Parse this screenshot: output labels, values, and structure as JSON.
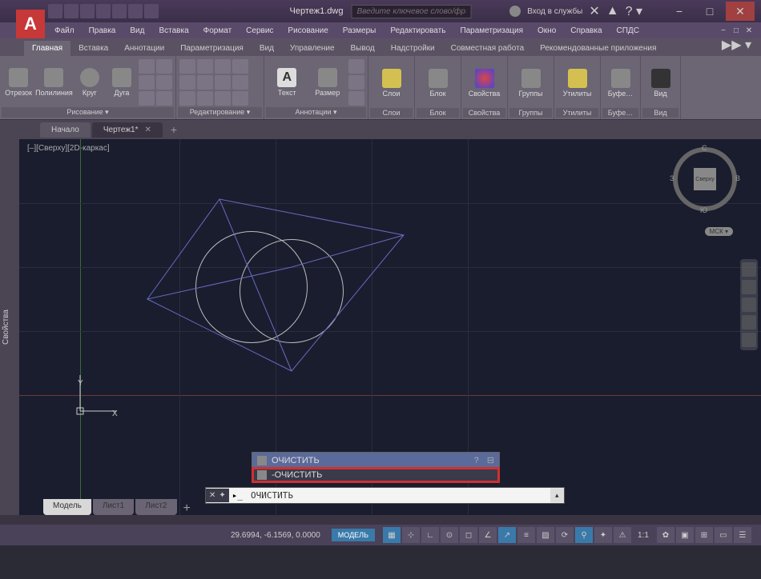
{
  "titlebar": {
    "doc_title": "Чертеж1.dwg",
    "search_placeholder": "Введите ключевое слово/фразу",
    "login_text": "Вход в службы"
  },
  "menubar": {
    "items": [
      "Файл",
      "Правка",
      "Вид",
      "Вставка",
      "Формат",
      "Сервис",
      "Рисование",
      "Размеры",
      "Редактировать",
      "Параметризация",
      "Окно",
      "Справка",
      "СПДС"
    ]
  },
  "ribbon_tabs": {
    "items": [
      "Главная",
      "Вставка",
      "Аннотации",
      "Параметризация",
      "Вид",
      "Управление",
      "Вывод",
      "Надстройки",
      "Совместная работа",
      "Рекомендованные приложения"
    ],
    "active": 0
  },
  "ribbon": {
    "draw": {
      "title": "Рисование ▾",
      "btns": [
        "Отрезок",
        "Полилиния",
        "Круг",
        "Дуга"
      ]
    },
    "edit": {
      "title": "Редактирование ▾"
    },
    "annot": {
      "title": "Аннотации ▾",
      "btns": [
        "Текст",
        "Размер"
      ]
    },
    "layers": {
      "title": "Слои",
      "btn": "Слои"
    },
    "block": {
      "title": "Блок",
      "btn": "Блок"
    },
    "props": {
      "title": "Свойства",
      "btn": "Свойства"
    },
    "groups": {
      "title": "Группы",
      "btn": "Группы"
    },
    "utils": {
      "title": "Утилиты",
      "btn": "Утилиты"
    },
    "clip": {
      "title": "Буфе…",
      "btn": "Буфе…"
    },
    "view": {
      "title": "Вид",
      "btn": "Вид"
    }
  },
  "doc_tabs": {
    "items": [
      "Начало",
      "Чертеж1*"
    ],
    "active": 1
  },
  "viewport": {
    "label": "[–][Сверху][2D-каркас]"
  },
  "side_panel": {
    "label": "Свойства"
  },
  "viewcube": {
    "face": "Сверху",
    "n": "С",
    "s": "Ю",
    "e": "В",
    "w": "З",
    "mck": "МСК ▾"
  },
  "ucs": {
    "x": "X",
    "y": "Y"
  },
  "cmd_suggest": {
    "items": [
      {
        "text": "ОЧИСТИТЬ",
        "selected": true
      },
      {
        "text": "-ОЧИСТИТЬ",
        "highlight": true
      }
    ]
  },
  "cmdline": {
    "prefix": ">_",
    "value": "ОЧИСТИТЬ"
  },
  "model_tabs": {
    "items": [
      "Модель",
      "Лист1",
      "Лист2"
    ],
    "active": 0
  },
  "statusbar": {
    "coords": "29.6994, -6.1569, 0.0000",
    "model_btn": "МОДЕЛЬ",
    "scale": "1:1"
  }
}
